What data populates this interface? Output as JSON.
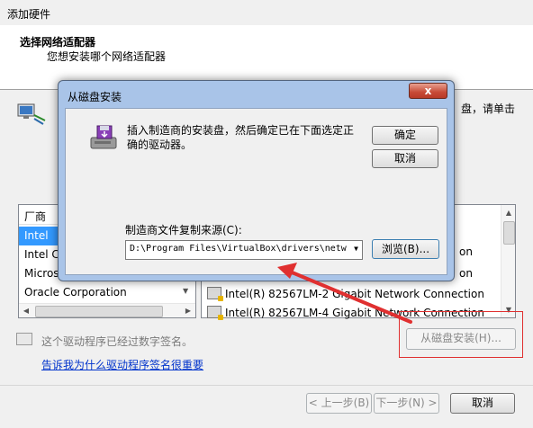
{
  "window": {
    "title": "添加硬件"
  },
  "header": {
    "title": "选择网络适配器",
    "subtitle": "您想安装哪个网络适配器"
  },
  "description_visible": "盘，请单击",
  "manufacturers": {
    "header": "厂商",
    "items": [
      "Intel",
      "Intel Co",
      "Microso",
      "Oracle Corporation"
    ],
    "selected_index": 0
  },
  "models": {
    "items": [
      "Intel(R) 82567LM-2 Gigabit Network Connection",
      "Intel(R) 82567LM-4 Gigabit Network Connection"
    ],
    "visible_fragments": [
      "on",
      "on"
    ]
  },
  "signature": {
    "text": "这个驱动程序已经过数字签名。",
    "link": "告诉我为什么驱动程序签名很重要"
  },
  "buttons": {
    "have_disk": "从磁盘安装(H)...",
    "back": "< 上一步(B)",
    "next": "下一步(N) >",
    "cancel": "取消"
  },
  "dialog": {
    "title": "从磁盘安装",
    "close": "x",
    "message": "插入制造商的安装盘，然后确定已在下面选定正确的驱动器。",
    "ok": "确定",
    "cancel": "取消",
    "copy_from_label": "制造商文件复制来源(C):",
    "path_value": "D:\\Program Files\\VirtualBox\\drivers\\netw",
    "browse": "浏览(B)..."
  },
  "colors": {
    "selection": "#3399ff",
    "annotation": "#e03030",
    "link": "#0033cc"
  }
}
